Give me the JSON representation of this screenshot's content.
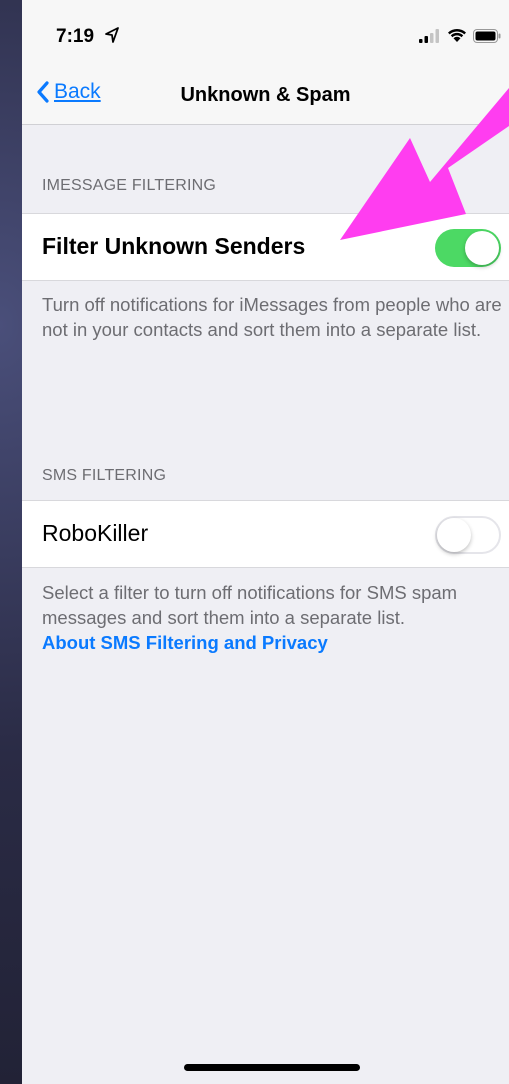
{
  "status_bar": {
    "time": "7:19"
  },
  "nav": {
    "back_label": "Back",
    "title": "Unknown & Spam"
  },
  "imessage_section": {
    "header": "IMESSAGE FILTERING",
    "row_label": "Filter Unknown Senders",
    "toggle_on": true,
    "footer": "Turn off notifications for iMessages from people who are not in your contacts and sort them into a separate list."
  },
  "sms_section": {
    "header": "SMS FILTERING",
    "row_label": "RoboKiller",
    "toggle_on": false,
    "footer": "Select a filter to turn off notifications for SMS spam messages and sort them into a separate list.",
    "link": "About SMS Filtering and Privacy"
  },
  "colors": {
    "accent": "#0a7aff",
    "toggle_on": "#4cd964",
    "annotation_arrow": "#ff3df0"
  }
}
